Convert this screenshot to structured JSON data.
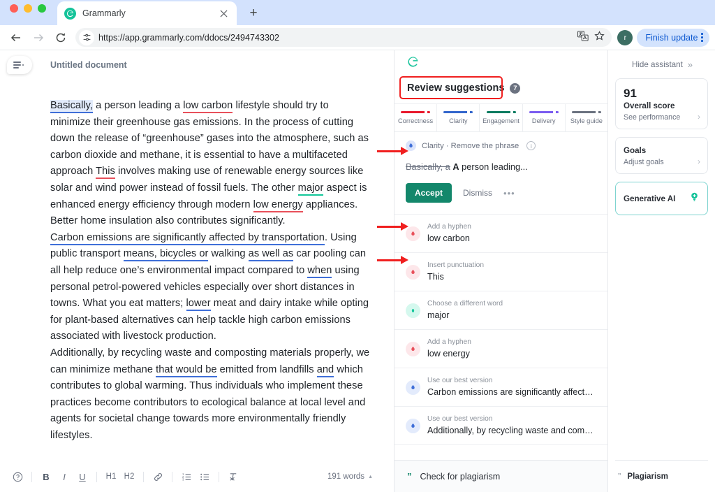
{
  "browser": {
    "tab": {
      "title": "Grammarly",
      "favicon": "grammarly-logo-icon",
      "close": "×"
    },
    "new_tab": "+",
    "nav": {
      "back": "←",
      "forward": "→",
      "reload": "⟳"
    },
    "omnibox": {
      "url": "https://app.grammarly.com/ddocs/2494743302",
      "tune_icon": "tune-icon"
    },
    "translate_icon": "translate-icon",
    "bookmark_icon": "star-icon",
    "avatar_initial": "r",
    "finish_update_label": "Finish update",
    "menu_icon": "kebab-menu-icon",
    "chevron_down": "⌄"
  },
  "editor": {
    "doc_title": "Untitled document",
    "menu_icon": "hamburger-menu-icon",
    "paragraphs": [
      {
        "id": "p1",
        "runs": [
          {
            "t": "Basically,",
            "mark": "hl-blue"
          },
          {
            "t": " a person leading a "
          },
          {
            "t": "low carbon",
            "mark": "u-red"
          },
          {
            "t": " lifestyle should try to minimize their greenhouse gas emissions. In the process of cutting down the release of “greenhouse” gases into the atmosphere, such as carbon dioxide and methane, it is essential to have a multifaceted approach "
          },
          {
            "t": "This",
            "mark": "u-red"
          },
          {
            "t": " involves making use of renewable energy sources like solar and wind power instead of fossil fuels. The other "
          },
          {
            "t": "major",
            "mark": "u-green"
          },
          {
            "t": " aspect is enhanced energy efficiency through modern "
          },
          {
            "t": "low energy",
            "mark": "u-red"
          },
          {
            "t": " appliances. Better home insulation also contributes significantly."
          }
        ]
      },
      {
        "id": "p2",
        "runs": [
          {
            "t": "Carbon emissions are significantly affected by transportation",
            "mark": "u-blue"
          },
          {
            "t": ". Using public transport "
          },
          {
            "t": "means, bicycles or",
            "mark": "u-blue"
          },
          {
            "t": " walking "
          },
          {
            "t": "as well as",
            "mark": "u-blue"
          },
          {
            "t": " car pooling can all help reduce one’s environmental impact compared to "
          },
          {
            "t": "when",
            "mark": "u-blue"
          },
          {
            "t": " using personal petrol-powered vehicles especially over short distances in towns. What you eat matters; "
          },
          {
            "t": "lower",
            "mark": "u-blue"
          },
          {
            "t": " meat and dairy intake while opting for plant-based alternatives can help tackle high carbon emissions associated with livestock production."
          }
        ]
      },
      {
        "id": "p3",
        "runs": [
          {
            "t": "Additionally, by recycling waste and composting materials properly, we can minimize methane "
          },
          {
            "t": "that would be",
            "mark": "u-blue"
          },
          {
            "t": " emitted from landfills "
          },
          {
            "t": "and",
            "mark": "u-blue"
          },
          {
            "t": " which contributes to global warming. Thus individuals who implement these practices become contributors to ecological balance at local level and agents for societal change towards more environmentally friendly lifestyles."
          }
        ]
      }
    ],
    "toolbar": {
      "help": "?",
      "bold": "B",
      "italic": "I",
      "underline": "U",
      "h1": "H1",
      "h2": "H2",
      "link": "link-icon",
      "ordered_list": "numbered-list-icon",
      "bullet_list": "bullet-list-icon",
      "clear_format": "clear-formatting-icon",
      "word_count": "191 words",
      "word_count_caret": "▲"
    }
  },
  "suggestions": {
    "logo": "grammarly-logo-icon",
    "title": "Review suggestions",
    "count": "7",
    "categories": [
      {
        "label": "Correctness",
        "color": "#e8192c"
      },
      {
        "label": "Clarity",
        "color": "#3366cc"
      },
      {
        "label": "Engagement",
        "color": "#0a7b5f"
      },
      {
        "label": "Delivery",
        "color": "#7b5cf0"
      },
      {
        "label": "Style guide",
        "color": "#6b7280"
      }
    ],
    "open_card": {
      "kind": "Clarity · Remove the phrase",
      "info_icon": "info-icon",
      "badge_color": "#3f6fd8",
      "strike_text": "Basically, a",
      "bold_text": "A",
      "rest_text": " person leading...",
      "accept_label": "Accept",
      "dismiss_label": "Dismiss",
      "more_label": "•••"
    },
    "items": [
      {
        "kind": "Add a hyphen",
        "text": "low carbon",
        "badge": "red"
      },
      {
        "kind": "Insert punctuation",
        "text": "This",
        "badge": "red"
      },
      {
        "kind": "Choose a different word",
        "text": "major",
        "badge": "green"
      },
      {
        "kind": "Add a hyphen",
        "text": "low energy",
        "badge": "red"
      },
      {
        "kind": "Use our best version",
        "text": "Carbon emissions are significantly affected by...",
        "badge": "blue"
      },
      {
        "kind": "Use our best version",
        "text": "Additionally, by recycling waste and composting...",
        "badge": "blue"
      }
    ],
    "plagiarism_label": "Check for plagiarism",
    "plagiarism_icon": "quote-icon"
  },
  "assistant": {
    "hide_label": "Hide assistant",
    "hide_icon": "double-chevron-right-icon",
    "score": {
      "value": "91",
      "label": "Overall score",
      "sub": "See performance",
      "arrow": "›"
    },
    "goals": {
      "label": "Goals",
      "sub": "Adjust goals",
      "arrow": "›"
    },
    "generative_ai": {
      "label": "Generative AI",
      "icon": "lightbulb-icon"
    },
    "plagiarism": {
      "label": "Plagiarism",
      "icon": "quote-icon"
    }
  }
}
